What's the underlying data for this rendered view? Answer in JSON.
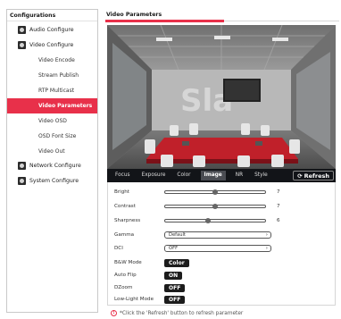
{
  "sidebar": {
    "title": "Configurations",
    "groups": [
      {
        "label": "Audio Configure",
        "icon": "audio-icon"
      },
      {
        "label": "Video Configure",
        "icon": "video-icon"
      },
      {
        "label": "Network Configure",
        "icon": "network-icon"
      },
      {
        "label": "System Configure",
        "icon": "system-icon"
      }
    ],
    "sub_items": [
      "Video Encode",
      "Stream Publish",
      "RTP Multicast",
      "Video Parameters",
      "Video OSD",
      "OSD Font Size",
      "Video Out"
    ],
    "active_item": "Video Parameters"
  },
  "main": {
    "title": "Video Parameters",
    "tabs": [
      "Focus",
      "Exposure",
      "Color",
      "Image",
      "NR",
      "Style"
    ],
    "active_tab": "Image",
    "refresh_label": "Refresh",
    "refresh_icon": "refresh-icon",
    "sliders": [
      {
        "label": "Bright",
        "value": "7",
        "level": 0.5
      },
      {
        "label": "Contrast",
        "value": "7",
        "level": 0.5
      },
      {
        "label": "Sharpness",
        "value": "6",
        "level": 0.43
      }
    ],
    "selects": [
      {
        "label": "Gamma",
        "value": "Default"
      },
      {
        "label": "DCI",
        "value": "OFF"
      }
    ],
    "toggles": [
      {
        "label": "B&W Mode",
        "value": "Color"
      },
      {
        "label": "Auto Flip",
        "value": "ON"
      },
      {
        "label": "DZoom",
        "value": "OFF"
      },
      {
        "label": "Low-Light Mode",
        "value": "OFF"
      }
    ],
    "note": "*Click the 'Refresh' button to refresh parameter"
  },
  "colors": {
    "accent": "#e8304a",
    "tabbar": "#121418",
    "toggle": "#1c1c1c"
  }
}
